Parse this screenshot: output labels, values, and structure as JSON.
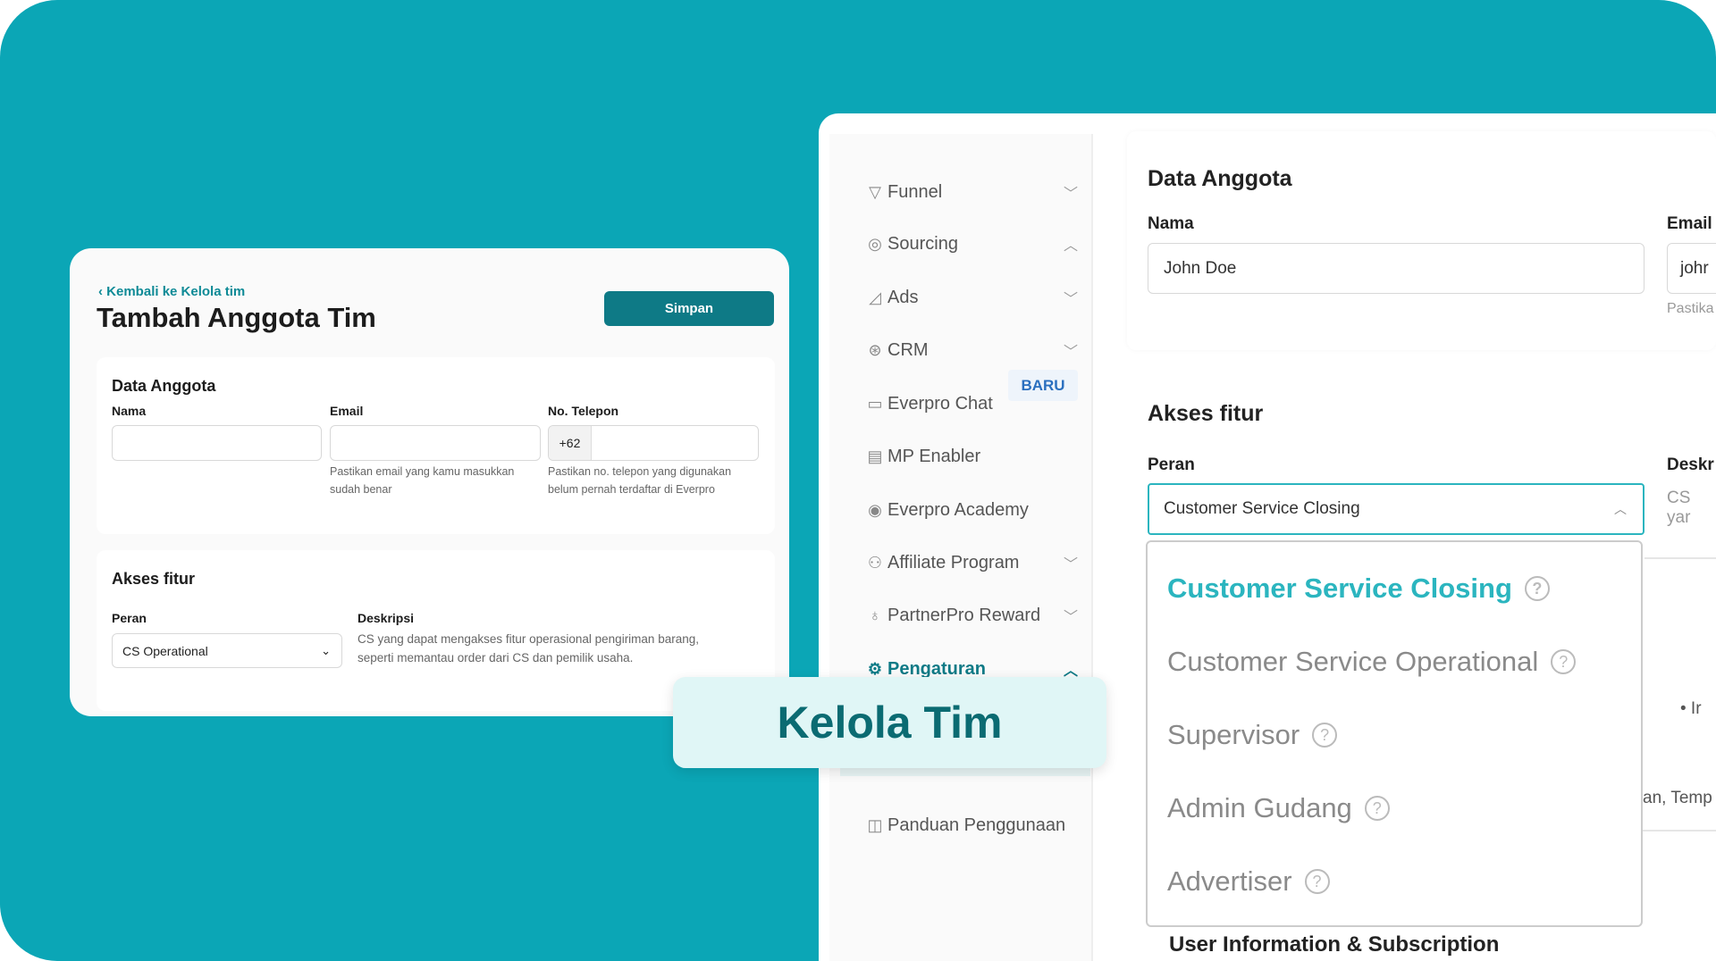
{
  "left_form": {
    "back_link": "Kembali ke Kelola tim",
    "title": "Tambah Anggota Tim",
    "save_label": "Simpan",
    "data_section": {
      "heading": "Data Anggota",
      "name_label": "Nama",
      "name_value": "",
      "email_label": "Email",
      "email_value": "",
      "email_hint_1": "Pastikan email yang kamu masukkan",
      "email_hint_2": "sudah benar",
      "phone_label": "No. Telepon",
      "phone_prefix": "+62",
      "phone_value": "",
      "phone_hint_1": "Pastikan no. telepon yang digunakan",
      "phone_hint_2": "belum pernah terdaftar di Everpro"
    },
    "access_section": {
      "heading": "Akses fitur",
      "role_label": "Peran",
      "role_value": "CS Operational",
      "desc_label": "Deskripsi",
      "desc_1": "CS yang dapat mengakses fitur operasional pengiriman barang,",
      "desc_2": "seperti memantau order dari CS dan pemilik usaha."
    }
  },
  "sidebar": {
    "items": [
      {
        "label": "Funnel",
        "icon": "funnel-icon",
        "chevron": "down"
      },
      {
        "label": "Sourcing",
        "icon": "sourcing-icon",
        "chevron": "up"
      },
      {
        "label": "Ads",
        "icon": "megaphone-icon",
        "chevron": "down"
      },
      {
        "label": "CRM",
        "icon": "crm-icon",
        "chevron": "down"
      },
      {
        "label": "Everpro Chat",
        "icon": "chat-icon",
        "badge": "BARU"
      },
      {
        "label": "MP Enabler",
        "icon": "store-icon"
      },
      {
        "label": "Everpro Academy",
        "icon": "academy-icon"
      },
      {
        "label": "Affiliate Program",
        "icon": "people-icon",
        "chevron": "down"
      },
      {
        "label": "PartnerPro Reward",
        "icon": "reward-icon",
        "chevron": "down"
      },
      {
        "label": "Pengaturan",
        "icon": "gear-icon",
        "chevron": "up",
        "active": true
      },
      {
        "label": "Panduan Penggunaan",
        "icon": "book-icon"
      }
    ]
  },
  "callout": "Kelola Tim",
  "right_form": {
    "heading": "Data Anggota",
    "name_label": "Nama",
    "name_value": "John Doe",
    "email_label": "Email",
    "email_value": "johr",
    "email_hint": "Pastika",
    "access_heading": "Akses fitur",
    "role_label": "Peran",
    "role_value": "Customer Service Closing",
    "desc_label": "Deskr",
    "desc_value": "CS yar",
    "behind_bullet": "• Ir",
    "behind_text": "an, Temp",
    "section_below": "User Information & Subscription",
    "options": [
      "Customer Service Closing",
      "Customer Service Operational",
      "Supervisor",
      "Admin Gudang",
      "Advertiser"
    ]
  },
  "colors": {
    "background": "#0ba6b6",
    "primary": "#0e7a86",
    "accent": "#2bb5bf",
    "callout_bg": "#e0f6f6"
  }
}
